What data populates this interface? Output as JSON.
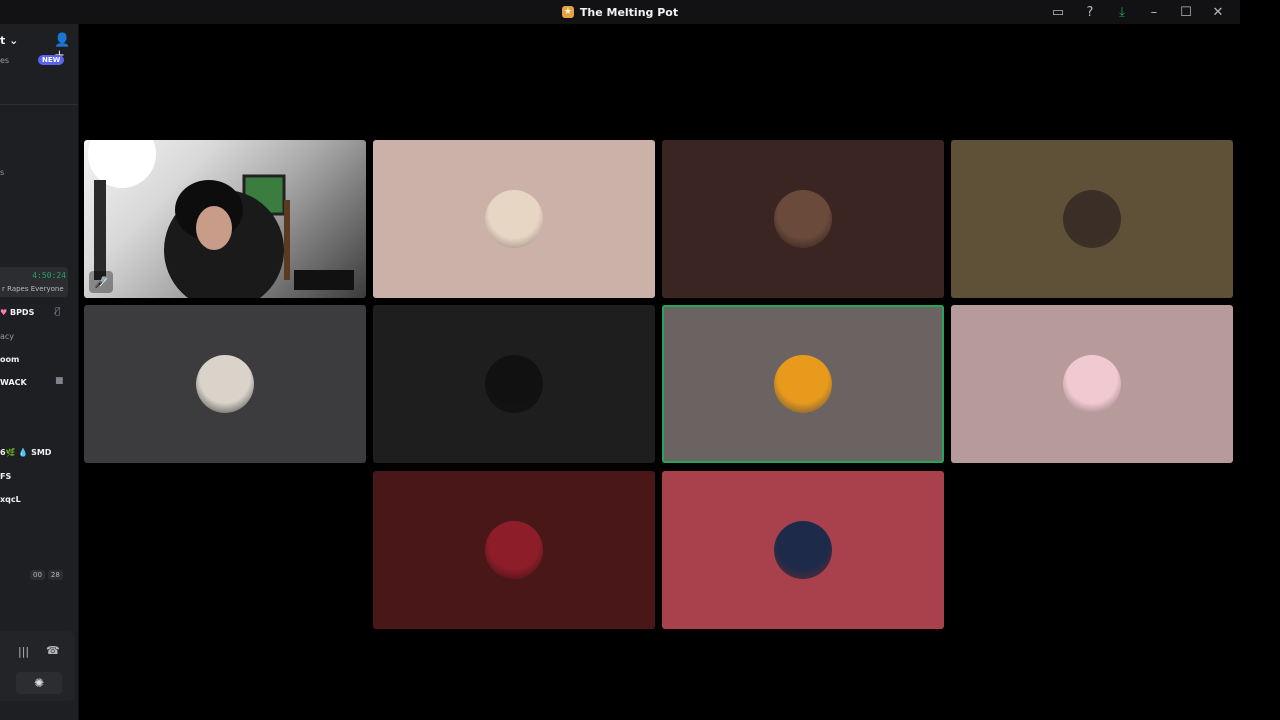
{
  "window": {
    "title": "The Melting Pot",
    "controls": [
      "inbox-icon",
      "help-icon",
      "download-icon",
      "minimize-icon",
      "maximize-icon",
      "close-icon"
    ]
  },
  "sidebar": {
    "server_name": "t",
    "partial_label_1": "es",
    "new_badge": "NEW",
    "partial_label_2": "s",
    "timer": "4:50:24",
    "status_text": "r Rapes Everyone",
    "members": [
      {
        "name": "BPDS",
        "prefix": "♥",
        "icon": "mic-muted-icon"
      },
      {
        "name": "acy",
        "prefix": "",
        "icon": ""
      },
      {
        "name": "oom",
        "prefix": "",
        "icon": ""
      },
      {
        "name": "WACK",
        "prefix": "",
        "icon": "camera-icon"
      },
      {
        "name": "SMD",
        "prefix": "6🌿 💧",
        "icon": ""
      },
      {
        "name": "FS",
        "prefix": "",
        "icon": ""
      },
      {
        "name": "xqcL",
        "prefix": "",
        "icon": ""
      }
    ],
    "pills": [
      "00",
      "28"
    ]
  },
  "voice_panel": {
    "icons": [
      "soundboard-icon",
      "disconnect-icon",
      "activity-icon"
    ]
  },
  "tiles": [
    {
      "kind": "camera",
      "bg": "#cfcfcf",
      "muted": true
    },
    {
      "kind": "avatar",
      "bg": "#ccb1a9",
      "avatar_color": "#e8d6c4",
      "muted": false
    },
    {
      "kind": "avatar",
      "bg": "#3a2522",
      "avatar_color": "#6a4a3a",
      "muted": false
    },
    {
      "kind": "avatar",
      "bg": "#5f5138",
      "avatar_color": "#3a2e26",
      "muted": false
    },
    {
      "kind": "avatar",
      "bg": "#3c3c3f",
      "avatar_color": "#d9d3c9",
      "muted": false
    },
    {
      "kind": "avatar",
      "bg": "#1e1e1f",
      "avatar_color": "#111111",
      "muted": false
    },
    {
      "kind": "avatar",
      "bg": "#6b6362",
      "avatar_color": "#e89a1d",
      "muted": false,
      "speaking": true
    },
    {
      "kind": "avatar",
      "bg": "#b79b9b",
      "avatar_color": "#f1c9d1",
      "muted": false
    },
    {
      "kind": "avatar",
      "bg": "#4a1719",
      "avatar_color": "#8e1d2a",
      "muted": false
    },
    {
      "kind": "avatar",
      "bg": "#a8414b",
      "avatar_color": "#1d2a4a",
      "muted": false
    }
  ]
}
